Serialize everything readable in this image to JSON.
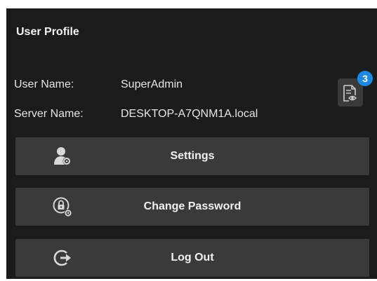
{
  "profile": {
    "title": "User Profile",
    "user_name_label": "User Name:",
    "user_name_value": "SuperAdmin",
    "server_name_label": "Server Name:",
    "server_name_value": "DESKTOP-A7QNM1A.local"
  },
  "notes": {
    "icon": "document-eye-icon",
    "badge_count": "3",
    "badge_color": "#1e88e5"
  },
  "actions": [
    {
      "label": "Settings",
      "icon": "user-gear-icon"
    },
    {
      "label": "Change Password",
      "icon": "lock-gear-icon"
    },
    {
      "label": "Log Out",
      "icon": "logout-icon"
    }
  ],
  "colors": {
    "panel_background": "#1b1b1b",
    "button_background": "#3a3a3a",
    "text": "#f2f2f2"
  }
}
